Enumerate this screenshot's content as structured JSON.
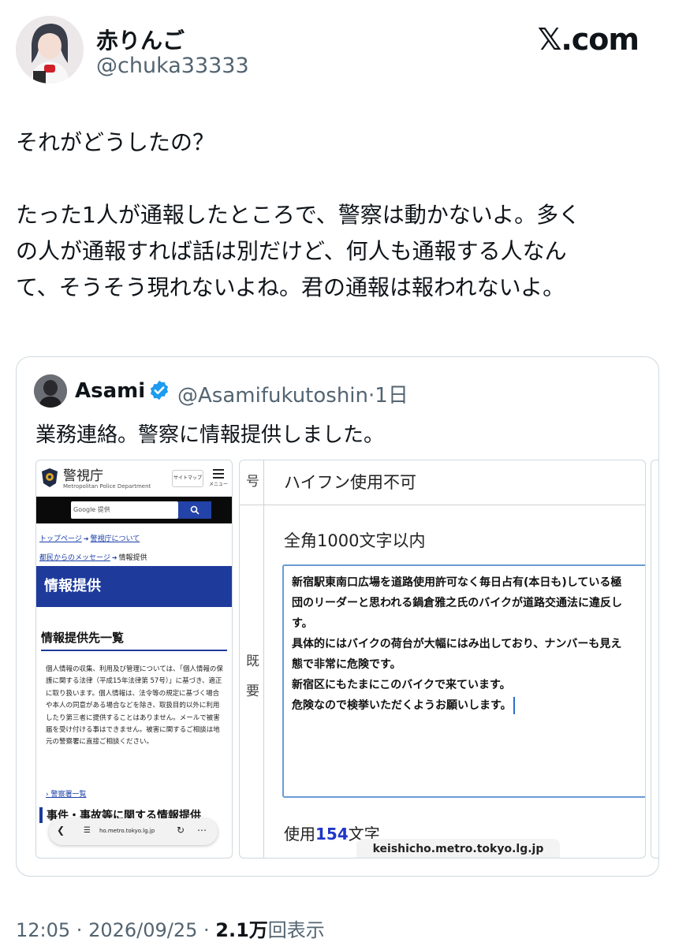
{
  "author": {
    "display_name": "赤りんご",
    "handle": "@chuka33333",
    "avatar_icon": "user-avatar"
  },
  "brand": "𝕏.com",
  "tweet": {
    "lines": [
      "それがどうしたの？",
      "",
      "たった1人が通報したところで、警察は動かないよ。多く",
      "の人が通報すれば話は別だけど、何人も通報する人なん",
      "て、そうそう現れないよね。君の通報は報われないよ。"
    ]
  },
  "quote": {
    "name": "Asami",
    "verified_icon": "verified-badge-icon",
    "handle": "@Asamifukutoshin",
    "separator": "·",
    "time": "1日",
    "text": "業務連絡。警察に情報提供しました。",
    "shot1": {
      "site_title": "警視庁",
      "site_subtitle": "Metropolitan Police Department",
      "sitemap_label": "サイトマップ",
      "menu_label": "メニュー",
      "search_placeholder": "Google 提供",
      "search_icon": "search-icon",
      "crumb_home": "トップページ",
      "crumb_about": "警視庁について",
      "crumb_messages": "都民からのメッセージ",
      "crumb_current": "情報提供",
      "banner": "情報提供",
      "section_title": "情報提供先一覧",
      "body": "個人情報の収集、利用及び管理については、「個人情報の保護に関する法律（平成15年法律第 57号）」に基づき、適正に取り扱います。個人情報は、法令等の規定に基づく場合や本人の同意がある場合などを除き、取扱目的以外に利用したり第三者に提供することはありません。メールで被害届を受け付ける事はできません。被害に関するご相談は地元の警察署に直接ご相談ください。",
      "link": "警察署一覧",
      "next_heading": "事件・事故等に関する情報提供",
      "url": "ho.metro.tokyo.lg.jp"
    },
    "shot2": {
      "row1_label": "ハイフン使用不可",
      "row2_label": "全角1000文字以内",
      "left_chars": [
        "号",
        "既",
        "要"
      ],
      "textarea_lines": [
        "新宿駅東南口広場を道路使用許可なく毎日占有(本日も)している極",
        "団のリーダーと思われる鍋倉雅之氏のバイクが道路交通法に違反し",
        "す。",
        "具体的にはバイクの荷台が大幅にはみ出しており、ナンバーも見え",
        "態で非常に危険です。",
        "新宿区にもたまにこのバイクで来ています。",
        "危険なので検挙いただくようお願いします。"
      ],
      "count_prefix": "使用",
      "count_value": "154",
      "count_suffix": "文字",
      "domain": "keishicho.metro.tokyo.lg.jp"
    }
  },
  "meta": {
    "time": "12:05",
    "date": "2026/09/25",
    "views": "2.1万",
    "views_label": "回表示"
  },
  "colors": {
    "text": "#0f1419",
    "secondary": "#536471",
    "border": "#cfd9de",
    "verified": "#1d9bf0",
    "police_blue": "#1e3b9c"
  }
}
